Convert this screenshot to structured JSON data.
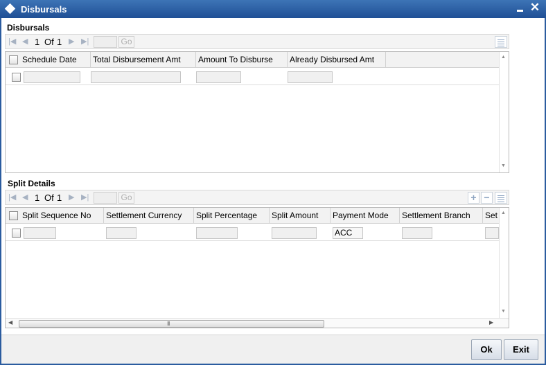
{
  "window": {
    "title": "Disbursals"
  },
  "disbursals": {
    "section_title": "Disbursals",
    "pager": {
      "current": "1",
      "of_label": "Of",
      "total": "1",
      "go_label": "Go"
    },
    "columns": [
      "Schedule Date",
      "Total Disbursement Amt",
      "Amount To Disburse",
      "Already Disbursed Amt"
    ],
    "rows": [
      {
        "schedule_date": "",
        "total_disbursement_amt": "",
        "amount_to_disburse": "",
        "already_disbursed_amt": ""
      }
    ]
  },
  "split_details": {
    "section_title": "Split Details",
    "pager": {
      "current": "1",
      "of_label": "Of",
      "total": "1",
      "go_label": "Go"
    },
    "columns": [
      "Split Sequence No",
      "Settlement Currency",
      "Split Percentage",
      "Split Amount",
      "Payment Mode",
      "Settlement Branch",
      "Set"
    ],
    "rows": [
      {
        "split_sequence_no": "",
        "settlement_currency": "",
        "split_percentage": "",
        "split_amount": "",
        "payment_mode": "ACC",
        "settlement_branch": "",
        "settlement_account": ""
      }
    ]
  },
  "footer": {
    "ok_label": "Ok",
    "exit_label": "Exit"
  }
}
